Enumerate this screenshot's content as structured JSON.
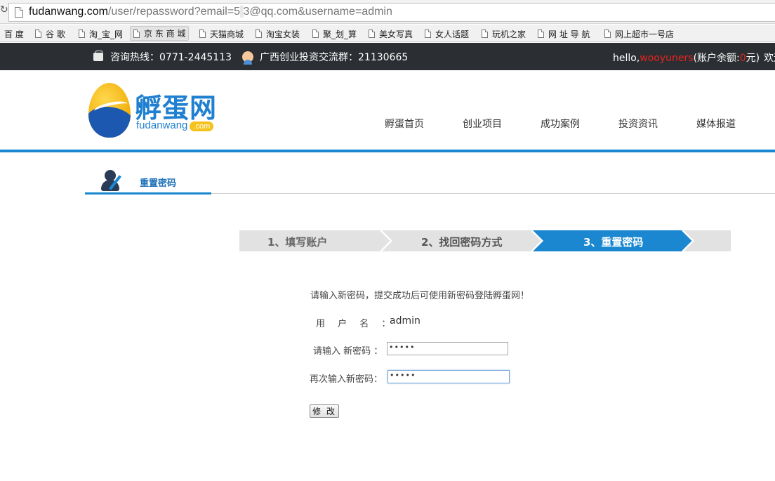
{
  "browser": {
    "url_host": "fudanwang.com",
    "url_path": "/user/repassword?email=5",
    "url_masked": "       ",
    "url_rest": "3@qq.com&username=admin",
    "bookmarks": [
      "百 度",
      "谷 歌",
      "淘_宝_网",
      "京 东 商 城",
      "天猫商城",
      "淘宝女装",
      "聚_划_算",
      "美女写真",
      "女人话题",
      "玩机之家",
      "网 址 导 航",
      "网上超市一号店"
    ]
  },
  "topbar": {
    "hotline": "咨询热线：0771-2445113",
    "qq_group": "广西创业投资交流群：21130665",
    "hello_prefix": "hello,",
    "username": "wooyuners",
    "balance_prefix": "(账户余额:",
    "balance_value": "0",
    "balance_suffix": "元)",
    "welcome": "欢迎"
  },
  "logo": {
    "cn": "孵蛋网",
    "en": "fudanwang",
    "com": ".com"
  },
  "nav": [
    "孵蛋首页",
    "创业项目",
    "成功案例",
    "投资资讯",
    "媒体报道"
  ],
  "section": {
    "title": "重置密码"
  },
  "steps": [
    "1、填写账户",
    "2、找回密码方式",
    "3、重置密码"
  ],
  "form": {
    "intro": "请输入新密码，提交成功后可使用新密码登陆孵蛋网！",
    "username_label": "用 户 名 ：",
    "username_value": "admin",
    "new_pwd_label": "请输入 新密码 ：",
    "new_pwd_value": "•••••",
    "confirm_pwd_label": "再次输入新密码：",
    "confirm_pwd_value": "•••••",
    "submit_label": "修 改"
  },
  "colors": {
    "accent": "#1a87d0",
    "active_step": "#1a87d0",
    "inactive_step": "#e2e2e2",
    "topbar": "#2b2f33",
    "highlight": "#e8231d"
  }
}
